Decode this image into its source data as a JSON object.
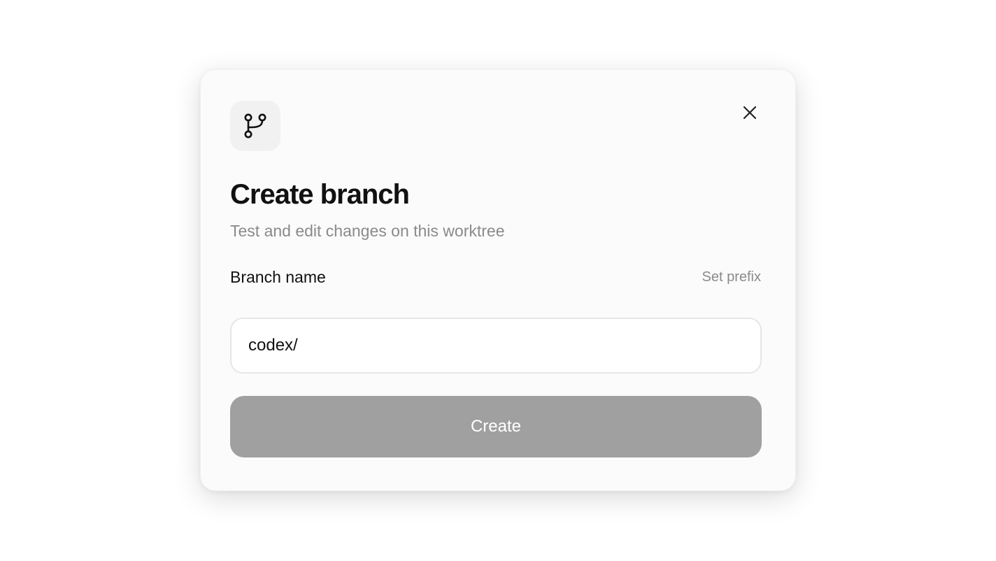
{
  "dialog": {
    "title": "Create branch",
    "subtitle": "Test and edit changes on this worktree",
    "header_icon": "git-branch-icon",
    "close_icon": "close-icon"
  },
  "form": {
    "branch_label": "Branch name",
    "set_prefix_label": "Set prefix",
    "branch_value": "codex/",
    "submit_label": "Create"
  },
  "colors": {
    "dialog_bg": "#fbfbfb",
    "icon_tile_bg": "#f1f1f1",
    "title": "#111111",
    "muted_text": "#8a8a8a",
    "input_border": "#e6e6e6",
    "button_disabled_bg": "#a0a0a0",
    "button_text": "#ffffff"
  }
}
